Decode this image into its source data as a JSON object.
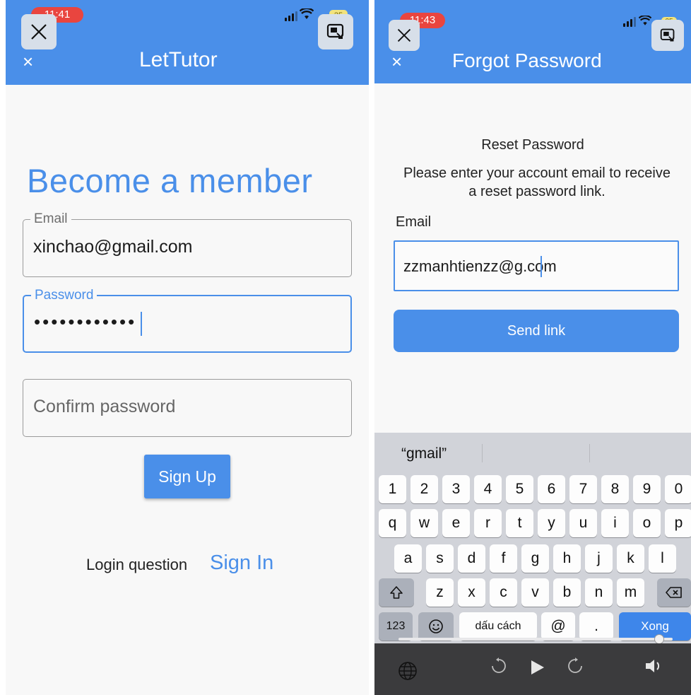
{
  "left": {
    "status": {
      "time": "11:41",
      "battery": "25"
    },
    "appbar": {
      "close": "×",
      "title": "LetTutor"
    },
    "heading": "Become a member",
    "email": {
      "label": "Email",
      "value": "xinchao@gmail.com"
    },
    "password": {
      "label": "Password",
      "masked": "••••••••••••"
    },
    "confirm": {
      "placeholder": "Confirm password"
    },
    "signup_label": "Sign Up",
    "login_question": "Login question",
    "sign_in_label": "Sign In"
  },
  "right": {
    "status": {
      "time": "11:43",
      "battery": "25"
    },
    "appbar": {
      "close": "×",
      "title": "Forgot Password"
    },
    "title": "Reset Password",
    "description": "Please enter your account email to receive a reset password link.",
    "email_label": "Email",
    "email_value": "zzmanhtienzz@g.com",
    "send_label": "Send link",
    "keyboard": {
      "suggestion": "“gmail”",
      "row_digits": [
        "1",
        "2",
        "3",
        "4",
        "5",
        "6",
        "7",
        "8",
        "9",
        "0"
      ],
      "row1": [
        "q",
        "w",
        "e",
        "r",
        "t",
        "y",
        "u",
        "i",
        "o",
        "p"
      ],
      "row2": [
        "a",
        "s",
        "d",
        "f",
        "g",
        "h",
        "j",
        "k",
        "l"
      ],
      "row3": [
        "z",
        "x",
        "c",
        "v",
        "b",
        "n",
        "m"
      ],
      "numbers_label": "123",
      "space_label": "dấu cách",
      "at_label": "@",
      "dot_label": ".",
      "done_label": "Xong"
    }
  }
}
